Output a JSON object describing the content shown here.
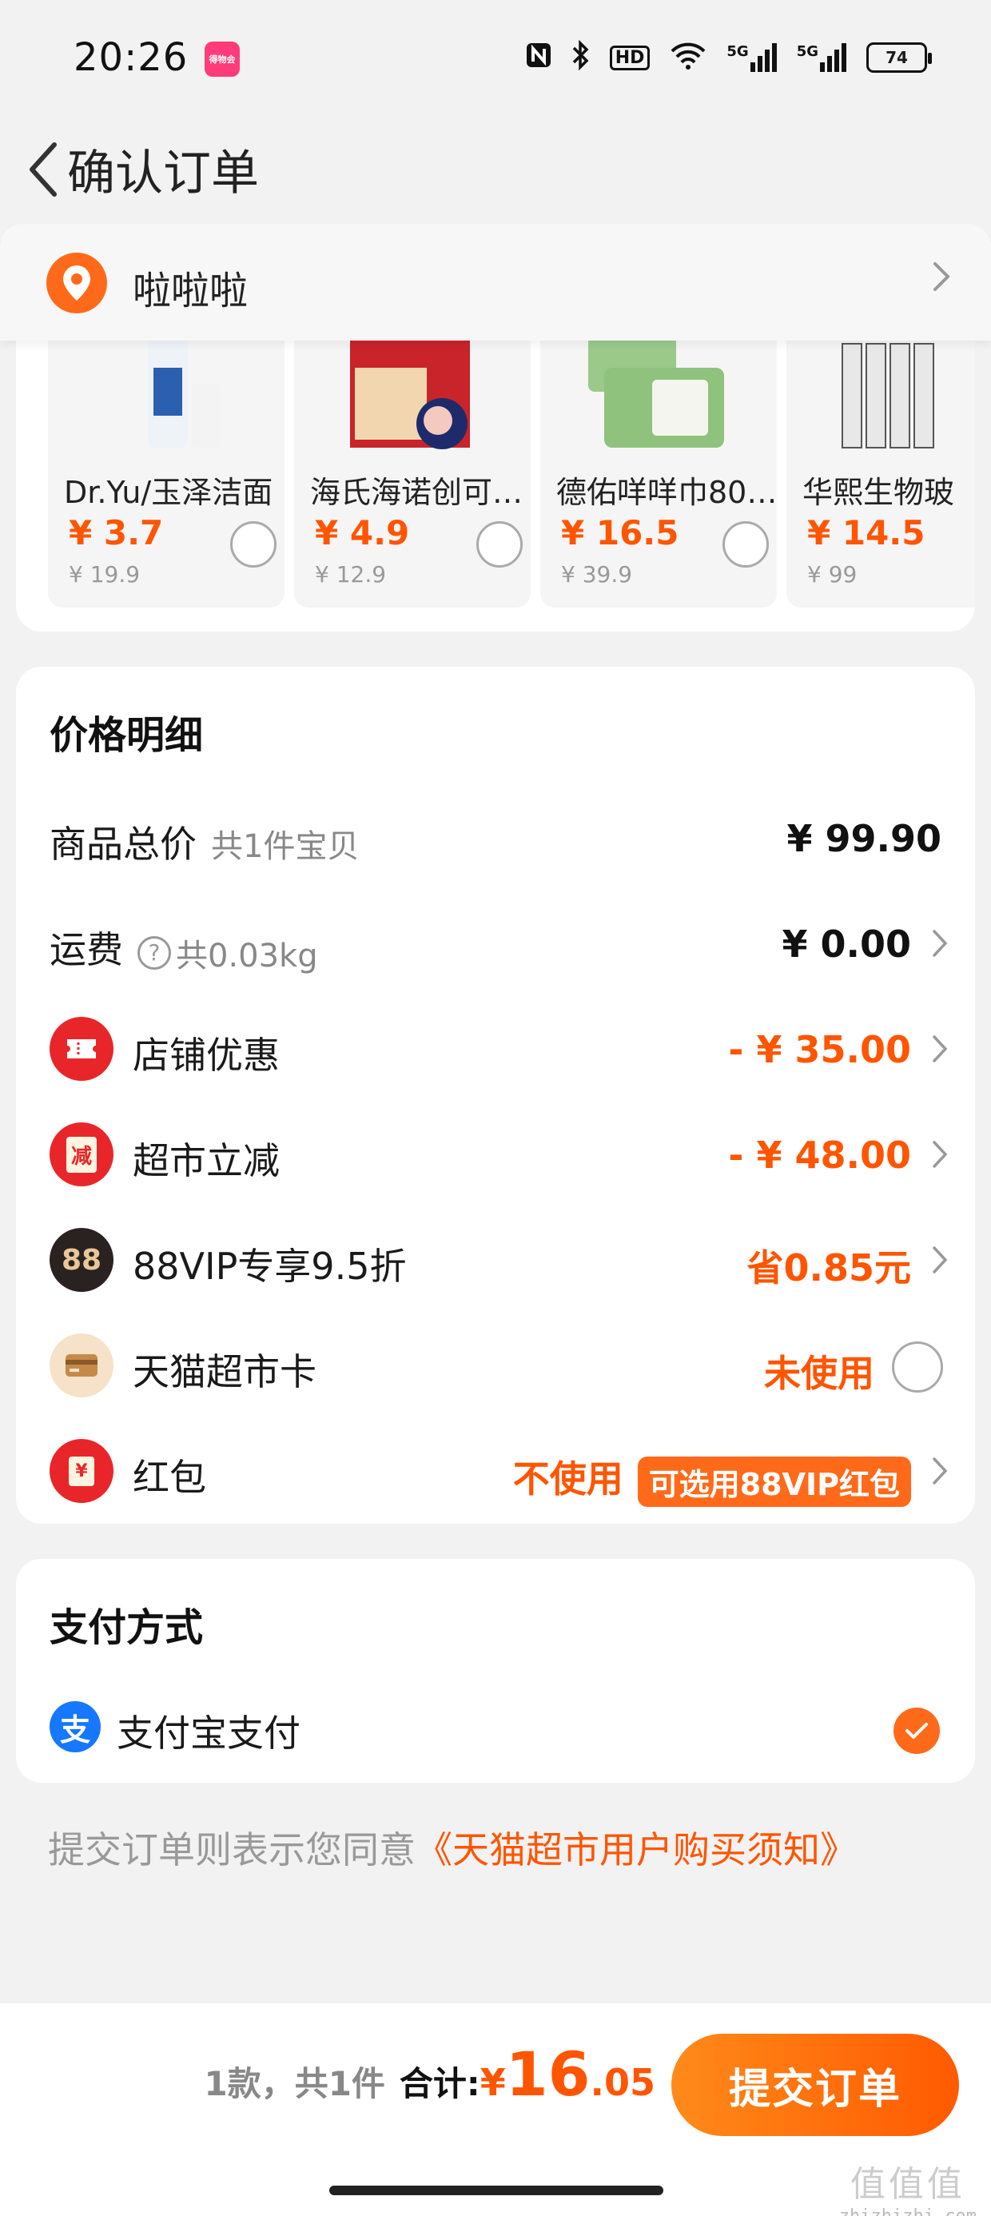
{
  "status_bar": {
    "time": "20:26",
    "app_badge": "得物会",
    "icons": [
      "nfc-icon",
      "bluetooth-icon",
      "hd-icon",
      "wifi-icon",
      "signal-5g-icon",
      "signal-5g-icon"
    ],
    "hd_label": "HD",
    "net1": "5G",
    "net2": "5G",
    "battery": "74"
  },
  "header": {
    "title": "确认订单"
  },
  "address": {
    "name": "啦啦啦"
  },
  "recommended": [
    {
      "name": "Dr.Yu/玉泽洁面",
      "price": "¥ 3.7",
      "original": "¥ 19.9"
    },
    {
      "name": "海氏海诺创可…",
      "price": "¥ 4.9",
      "original": "¥ 12.9"
    },
    {
      "name": "德佑咩咩巾80…",
      "price": "¥ 16.5",
      "original": "¥ 39.9"
    },
    {
      "name": "华熙生物玻",
      "price": "¥ 14.5",
      "original": "¥ 99"
    }
  ],
  "price_detail": {
    "title": "价格明细",
    "goods_total": {
      "label": "商品总价",
      "sub": "共1件宝贝",
      "value": "¥ 99.90"
    },
    "shipping": {
      "label": "运费",
      "help": "?",
      "sub": "共0.03kg",
      "value": "¥ 0.00"
    },
    "store_discount": {
      "label": "店铺优惠",
      "value": "- ¥ 35.00"
    },
    "market_discount": {
      "label": "超市立减",
      "icon_text": "减",
      "value": "- ¥ 48.00"
    },
    "vip": {
      "label": "88VIP专享9.5折",
      "icon_text": "88",
      "value": "省0.85元"
    },
    "tmall_card": {
      "label": "天猫超市卡",
      "value": "未使用"
    },
    "red_packet": {
      "label": "红包",
      "icon_text": "¥",
      "value": "不使用",
      "tag": "可选用88VIP红包"
    }
  },
  "payment": {
    "title": "支付方式",
    "method": "支付宝支付",
    "icon_text": "支"
  },
  "agreement": {
    "text": "提交订单则表示您同意",
    "link": "《天猫超市用户购买须知》"
  },
  "bottom": {
    "count": "1款，共1件",
    "total_label": "合计:",
    "total_yen": "¥",
    "total_int": "16",
    "total_dec": ".05",
    "submit": "提交订单",
    "watermark_big": "值值值",
    "watermark_small": "zhizhizhi.com"
  },
  "colors": {
    "accent": "#ff5500",
    "primary_button": "#ff6a1a",
    "alipay": "#1677ff",
    "red_icon": "#e8262a",
    "vip_icon": "#2a2220"
  }
}
